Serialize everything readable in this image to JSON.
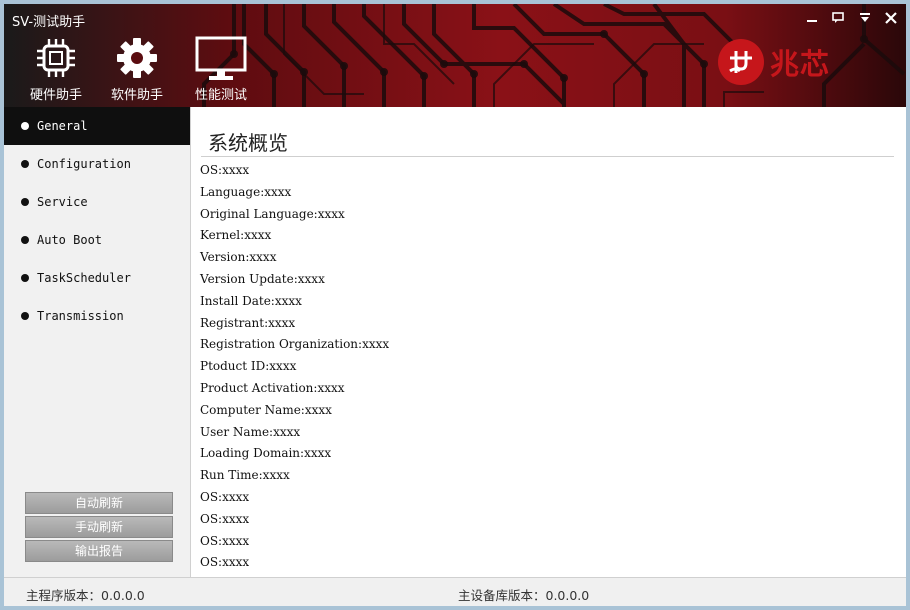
{
  "app": {
    "title": "SV-测试助手",
    "window_buttons": [
      "minimize-icon",
      "feedback-icon",
      "dropdown-icon",
      "close-icon"
    ]
  },
  "toolbar": {
    "items": [
      {
        "label": "硬件助手",
        "icon": "chip-icon"
      },
      {
        "label": "软件助手",
        "icon": "gear-icon"
      },
      {
        "label": "性能测试",
        "icon": "monitor-icon"
      }
    ]
  },
  "brand": {
    "text": "兆芯",
    "color": "#c6161b"
  },
  "sidebar": {
    "items": [
      {
        "label": "General",
        "active": true
      },
      {
        "label": "Configuration",
        "active": false
      },
      {
        "label": "Service",
        "active": false
      },
      {
        "label": "Auto Boot",
        "active": false
      },
      {
        "label": "TaskScheduler",
        "active": false
      },
      {
        "label": "Transmission",
        "active": false
      }
    ],
    "buttons": {
      "auto_refresh": "自动刷新",
      "manual_refresh": "手动刷新",
      "export_report": "输出报告"
    }
  },
  "main": {
    "title": "系统概览",
    "lines": [
      "OS:xxxx",
      "Language:xxxx",
      "Original Language:xxxx",
      "Kernel:xxxx",
      "Version:xxxx",
      "Version Update:xxxx",
      "Install Date:xxxx",
      "Registrant:xxxx",
      "Registration Organization:xxxx",
      "Ptoduct ID:xxxx",
      "Product Activation:xxxx",
      "Computer Name:xxxx",
      "User Name:xxxx",
      "Loading Domain:xxxx",
      "Run Time:xxxx",
      "OS:xxxx",
      "OS:xxxx",
      "OS:xxxx",
      "OS:xxxx"
    ]
  },
  "status": {
    "main_version": "主程序版本：0.0.0.0",
    "device_db_version": "主设备库版本：0.0.0.0"
  }
}
